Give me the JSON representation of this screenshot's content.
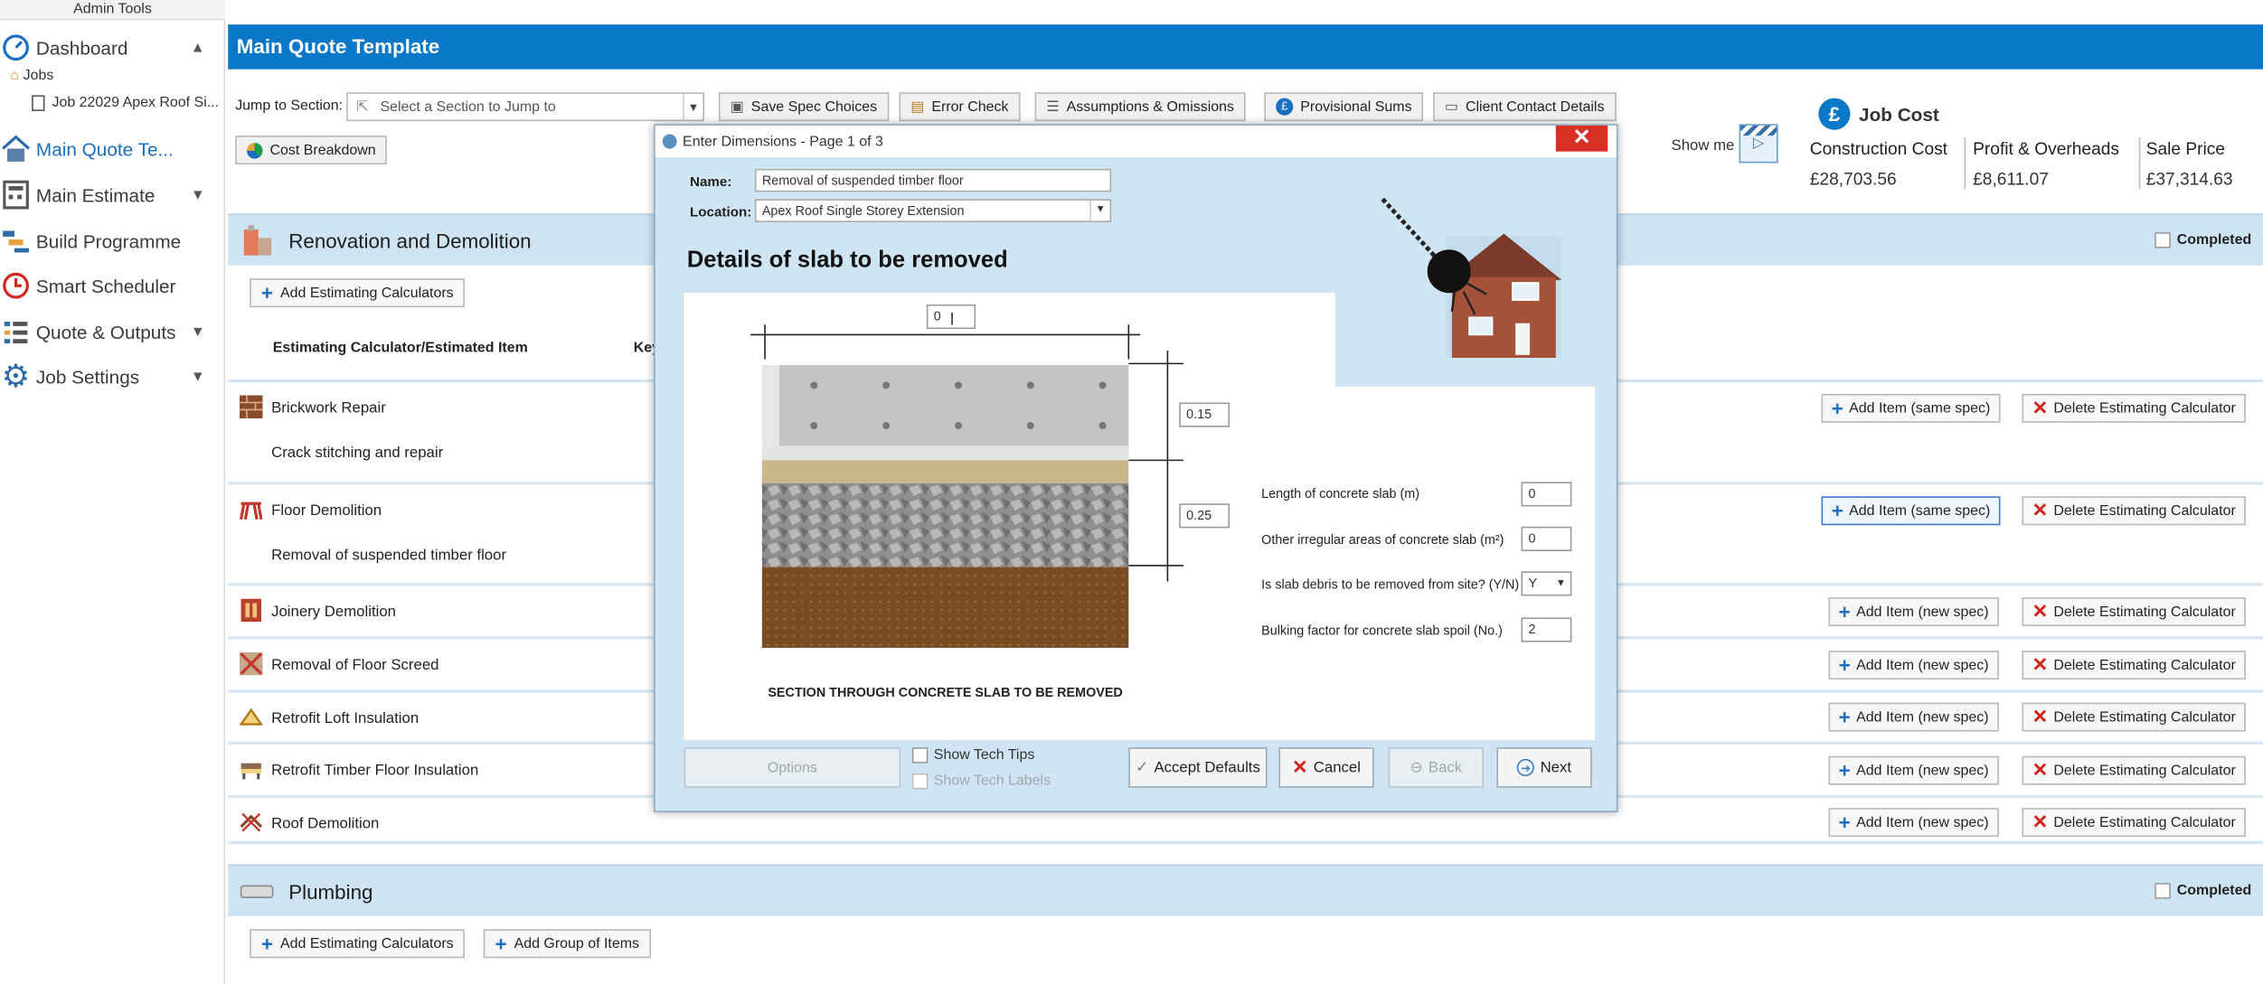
{
  "app": {
    "admin_tools": "Admin Tools"
  },
  "sidebar": {
    "items": [
      {
        "label": "Dashboard"
      },
      {
        "label": "Main Quote Te..."
      },
      {
        "label": "Main Estimate"
      },
      {
        "label": "Build Programme"
      },
      {
        "label": "Smart Scheduler"
      },
      {
        "label": "Quote & Outputs"
      },
      {
        "label": "Job Settings"
      }
    ],
    "jobs_label": "Jobs",
    "job_label": "Job 22029 Apex Roof Si..."
  },
  "header": {
    "title": "Main Quote Template",
    "jump_label": "Jump to Section:",
    "jump_placeholder": "Select a Section to Jump to",
    "buttons": {
      "save_spec": "Save Spec Choices",
      "error_check": "Error Check",
      "assumptions": "Assumptions & Omissions",
      "provisional": "Provisional Sums",
      "client_contact": "Client Contact Details",
      "cost_breakdown": "Cost Breakdown"
    },
    "show_me": "Show me"
  },
  "job_cost": {
    "title": "Job Cost",
    "construction_label": "Construction Cost",
    "construction_value": "£28,703.56",
    "profit_label": "Profit & Overheads",
    "profit_value": "£8,611.07",
    "sale_label": "Sale Price",
    "sale_value": "£37,314.63"
  },
  "renovation": {
    "title": "Renovation and Demolition",
    "completed": "Completed",
    "add_calc": "Add Estimating Calculators",
    "col_header": "Estimating Calculator/Estimated Item",
    "col_header2": "Key",
    "rows": [
      {
        "name": "Brickwork Repair",
        "sub": "Crack stitching and repair",
        "add": "Add Item (same spec)",
        "del": "Delete Estimating Calculator"
      },
      {
        "name": "Floor Demolition",
        "sub": "Removal of suspended timber floor",
        "add": "Add Item (same spec)",
        "del": "Delete Estimating Calculator"
      },
      {
        "name": "Joinery Demolition",
        "add": "Add Item (new spec)",
        "del": "Delete Estimating Calculator"
      },
      {
        "name": "Removal of Floor Screed",
        "add": "Add Item (new spec)",
        "del": "Delete Estimating Calculator"
      },
      {
        "name": "Retrofit Loft Insulation",
        "add": "Add Item (new spec)",
        "del": "Delete Estimating Calculator"
      },
      {
        "name": "Retrofit Timber Floor Insulation",
        "add": "Add Item (new spec)",
        "del": "Delete Estimating Calculator"
      },
      {
        "name": "Roof Demolition",
        "add": "Add Item (new spec)",
        "del": "Delete Estimating Calculator"
      }
    ]
  },
  "plumbing": {
    "title": "Plumbing",
    "completed": "Completed",
    "add_calc": "Add Estimating Calculators",
    "add_group": "Add Group of Items"
  },
  "dialog": {
    "title": "Enter Dimensions - Page 1 of 3",
    "name_label": "Name:",
    "name_value": "Removal of suspended timber floor",
    "location_label": "Location:",
    "location_value": "Apex Roof Single Storey Extension",
    "heading": "Details of slab to be removed",
    "width_value": "0",
    "dim1": "0.15",
    "dim2": "0.25",
    "caption": "SECTION THROUGH CONCRETE SLAB TO BE REMOVED",
    "fields": [
      {
        "label": "Length of concrete slab (m)",
        "value": "0"
      },
      {
        "label": "Other irregular areas of concrete slab (m²)",
        "value": "0"
      },
      {
        "label": "Is slab debris to be removed from site? (Y/N)",
        "value": "Y"
      },
      {
        "label": "Bulking factor for concrete slab spoil (No.)",
        "value": "2"
      }
    ],
    "options": "Options",
    "show_tech_tips": "Show Tech Tips",
    "show_tech_labels": "Show Tech Labels",
    "accept": "Accept Defaults",
    "cancel": "Cancel",
    "back": "Back",
    "next": "Next"
  }
}
